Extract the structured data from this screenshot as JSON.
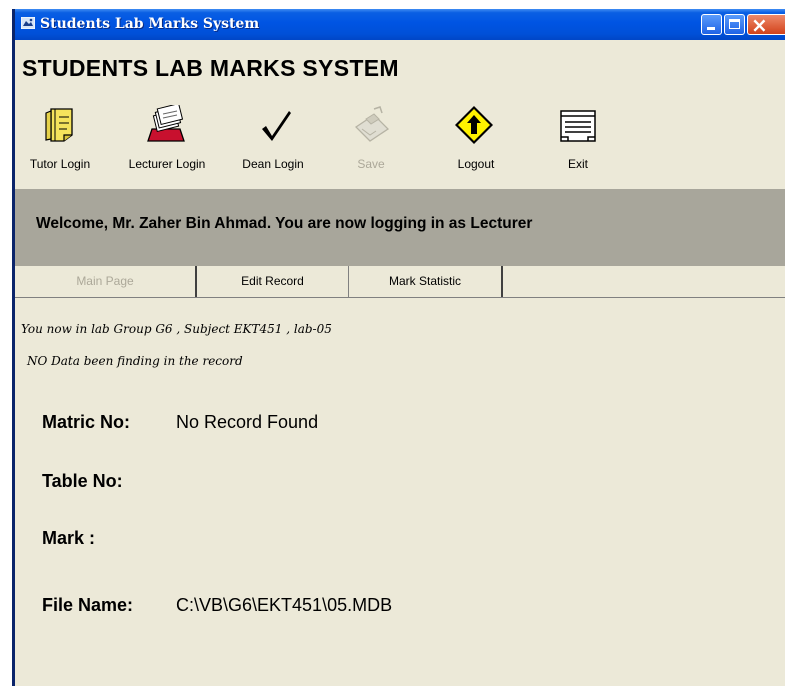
{
  "window": {
    "title": "Students Lab Marks System"
  },
  "header": {
    "app_title": "STUDENTS LAB MARKS SYSTEM"
  },
  "toolbar": {
    "items": [
      {
        "label": "Tutor Login",
        "icon": "notebook-icon",
        "enabled": true
      },
      {
        "label": "Lecturer Login",
        "icon": "card-file-icon",
        "enabled": true
      },
      {
        "label": "Dean Login",
        "icon": "checkmark-icon",
        "enabled": true
      },
      {
        "label": "Save",
        "icon": "disk-icon",
        "enabled": false
      },
      {
        "label": "Logout",
        "icon": "warning-arrow-icon",
        "enabled": true
      },
      {
        "label": "Exit",
        "icon": "note-pad-icon",
        "enabled": true
      }
    ]
  },
  "banner": {
    "text": "Welcome, Mr. Zaher Bin Ahmad. You are now logging in as Lecturer"
  },
  "tabs": [
    {
      "label": "Main Page",
      "active": true
    },
    {
      "label": "Edit Record",
      "active": false
    },
    {
      "label": "Mark Statistic",
      "active": false
    }
  ],
  "main": {
    "status_line1": "You now in lab Group G6 , Subject EKT451 , lab-05",
    "status_line2": "NO Data been finding in the record",
    "matric_label": "Matric No:",
    "matric_value": "No Record Found",
    "table_label": "Table  No:",
    "table_value": "",
    "mark_label": "Mark :",
    "mark_value": "",
    "file_label": "File Name:",
    "file_value": "C:\\VB\\G6\\EKT451\\05.MDB"
  },
  "colors": {
    "titlebar": "#0054e3",
    "window_bg": "#ece9d8",
    "banner_bg": "#a8a69b",
    "close_button": "#d2421b"
  }
}
